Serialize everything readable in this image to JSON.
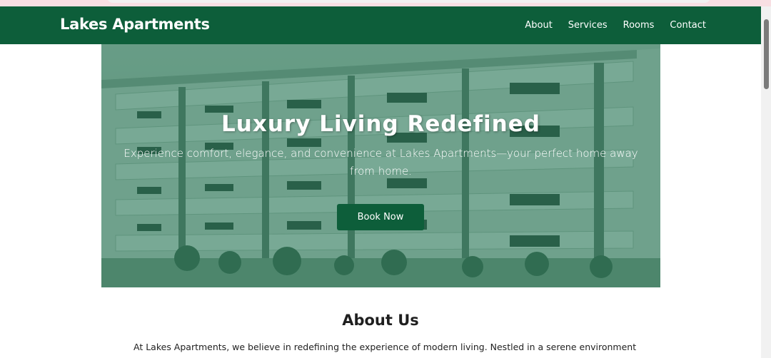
{
  "header": {
    "brand": "Lakes Apartments",
    "nav": [
      "About",
      "Services",
      "Rooms",
      "Contact"
    ]
  },
  "hero": {
    "title": "Luxury Living Redefined",
    "subtitle": "Experience comfort, elegance, and convenience at Lakes Apartments—your perfect home away from home.",
    "button": "Book Now"
  },
  "about": {
    "title": "About Us",
    "text": "At Lakes Apartments, we believe in redefining the experience of modern living. Nestled in a serene environment yet"
  },
  "colors": {
    "primary": "#0d5e3a",
    "overlay": "#186e4a",
    "browser_bar": "#f8dfe3"
  },
  "icons": [
    "hero-building-image"
  ]
}
